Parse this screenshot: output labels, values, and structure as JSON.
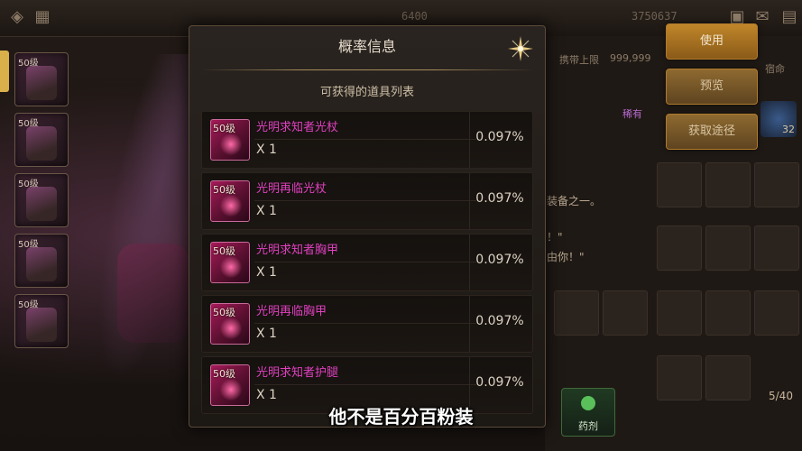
{
  "modal": {
    "title": "概率信息",
    "subtitle": "可获得的道具列表",
    "items": [
      {
        "level": "50级",
        "name": "光明求知者光杖",
        "qty": "X 1",
        "prob": "0.097%"
      },
      {
        "level": "50级",
        "name": "光明再临光杖",
        "qty": "X 1",
        "prob": "0.097%"
      },
      {
        "level": "50级",
        "name": "光明求知者胸甲",
        "qty": "X 1",
        "prob": "0.097%"
      },
      {
        "level": "50级",
        "name": "光明再临胸甲",
        "qty": "X 1",
        "prob": "0.097%"
      },
      {
        "level": "50级",
        "name": "光明求知者护腿",
        "qty": "X 1",
        "prob": "0.097%"
      }
    ]
  },
  "equip_slots": [
    {
      "level": "50级"
    },
    {
      "level": "50级"
    },
    {
      "level": "50级"
    },
    {
      "level": "50级"
    },
    {
      "level": "50级"
    }
  ],
  "right_panel": {
    "buttons": [
      "使用",
      "预览",
      "获取途径"
    ],
    "rarity": "稀有",
    "limit_label": "携带上限",
    "limit_value": "999,999",
    "tab_label": "宿命",
    "text_lines": [
      "装备之一。",
      "！\"",
      "由你！\""
    ],
    "corner_count": "32",
    "page_count": "5/40",
    "potion_label": "药剂"
  },
  "topbar": {
    "stat1": "6400",
    "stat2": "3750637"
  },
  "caption": "他不是百分百粉装",
  "colors": {
    "item_name": "#e040c0",
    "button_gold": "#c0862a",
    "modal_bg": "#2a2420"
  }
}
